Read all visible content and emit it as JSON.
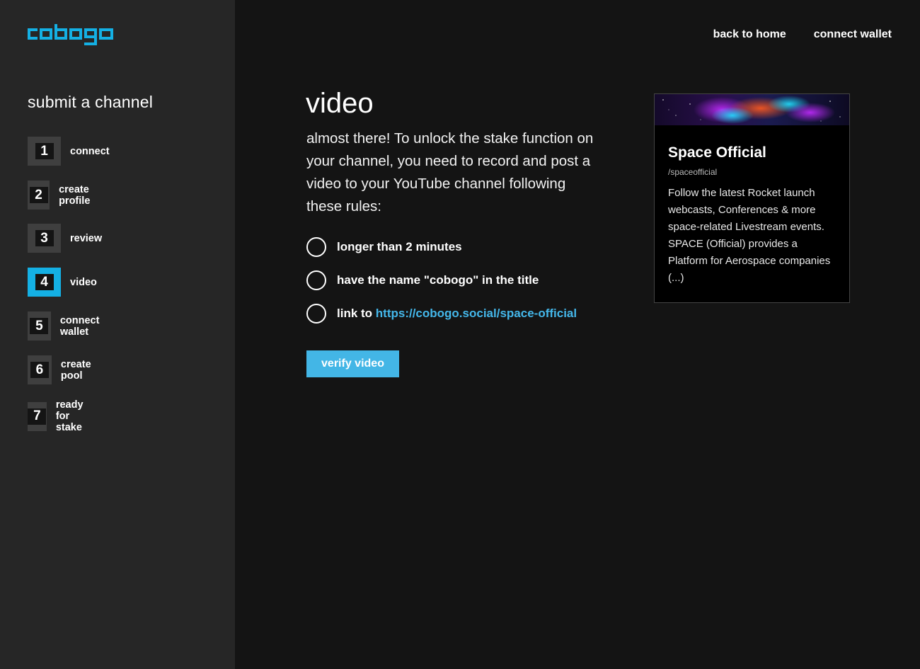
{
  "brand": {
    "name": "cobogo",
    "color": "#14b0e4"
  },
  "nav": {
    "back_to_home": "back to home",
    "connect_wallet": "connect wallet"
  },
  "sidebar": {
    "title": "submit a channel",
    "active_step": 4,
    "steps": [
      {
        "number": "1",
        "label": "connect"
      },
      {
        "number": "2",
        "label": "create profile"
      },
      {
        "number": "3",
        "label": "review"
      },
      {
        "number": "4",
        "label": "video"
      },
      {
        "number": "5",
        "label": "connect wallet"
      },
      {
        "number": "6",
        "label": "create pool"
      },
      {
        "number": "7",
        "label": "ready for stake"
      }
    ]
  },
  "main": {
    "title": "video",
    "intro": "almost there! To unlock the stake function on your channel, you need to record and post a video to your YouTube channel following these rules:",
    "rules": [
      {
        "text": "longer than 2 minutes"
      },
      {
        "text": "have the name \"cobogo\" in the title"
      },
      {
        "prefix": "link to ",
        "link": "https://cobogo.social/space-official"
      }
    ],
    "verify_button": "verify video"
  },
  "channel_card": {
    "name": "Space Official",
    "handle": "/spaceofficial",
    "description": "Follow the latest Rocket launch webcasts, Conferences & more space-related Livestream events. SPACE (Official) provides a Platform for Aerospace companies (...)"
  },
  "colors": {
    "accent": "#14b0e4",
    "button": "#43b6e6",
    "link": "#44b7ea",
    "sidebar_bg": "#262626",
    "main_bg": "#141414"
  }
}
